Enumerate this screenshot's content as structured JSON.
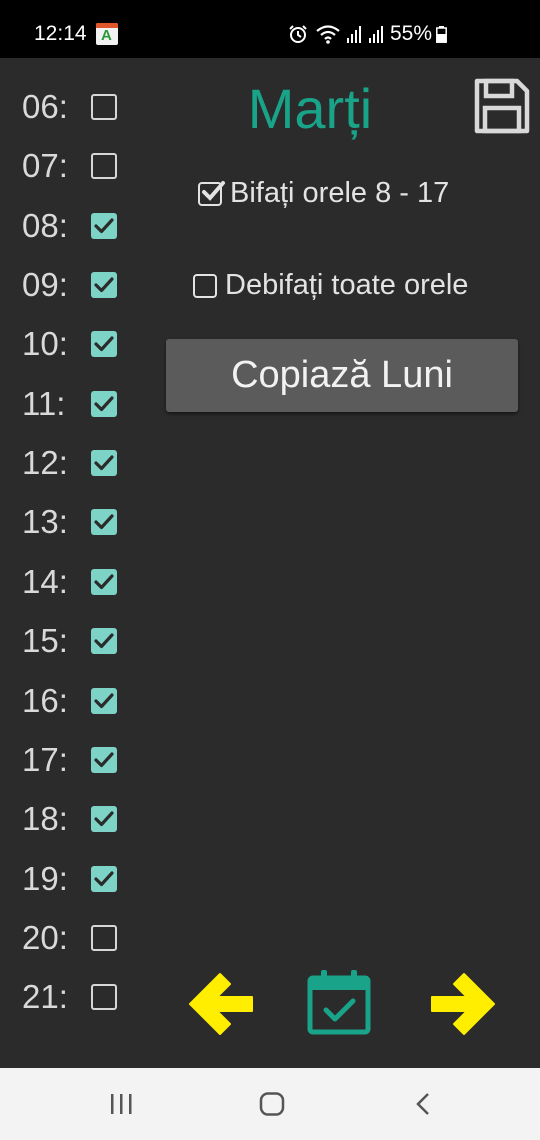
{
  "status_bar": {
    "time": "12:14",
    "battery_text": "55%",
    "icons": [
      "app-icon",
      "alarm-icon",
      "wifi-icon",
      "signal-icon",
      "signal-icon",
      "battery-icon"
    ]
  },
  "day_title": "Marți",
  "hours": [
    {
      "label": "06:",
      "checked": false
    },
    {
      "label": "07:",
      "checked": false
    },
    {
      "label": "08:",
      "checked": true
    },
    {
      "label": "09:",
      "checked": true
    },
    {
      "label": "10:",
      "checked": true
    },
    {
      "label": "11:",
      "checked": true
    },
    {
      "label": "12:",
      "checked": true
    },
    {
      "label": "13:",
      "checked": true
    },
    {
      "label": "14:",
      "checked": true
    },
    {
      "label": "15:",
      "checked": true
    },
    {
      "label": "16:",
      "checked": true
    },
    {
      "label": "17:",
      "checked": true
    },
    {
      "label": "18:",
      "checked": true
    },
    {
      "label": "19:",
      "checked": true
    },
    {
      "label": "20:",
      "checked": false
    },
    {
      "label": "21:",
      "checked": false
    }
  ],
  "options": {
    "check_range_label": "Bifați orele 8 - 17",
    "check_range_checked": true,
    "uncheck_all_label": "Debifați toate orele",
    "uncheck_all_checked": false
  },
  "copy_button_label": "Copiază Luni",
  "colors": {
    "accent": "#19a389",
    "checkbox_checked": "#7ed3c7",
    "arrow": "#ffee00",
    "background": "#2b2b2b"
  },
  "nav": [
    "recent-apps-icon",
    "home-icon",
    "back-icon"
  ]
}
